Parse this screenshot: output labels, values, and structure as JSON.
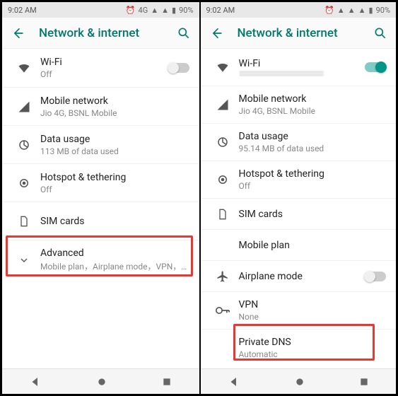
{
  "left": {
    "status": {
      "time": "9:02 AM",
      "battery": "90%"
    },
    "appbar": {
      "title": "Network & internet"
    },
    "wifi": {
      "title": "Wi-Fi",
      "sub": "Off",
      "on": false
    },
    "mobile": {
      "title": "Mobile network",
      "sub": "Jio 4G, BSNL Mobile"
    },
    "datausage": {
      "title": "Data usage",
      "sub": "113 MB of data used"
    },
    "hotspot": {
      "title": "Hotspot & tethering",
      "sub": "Off"
    },
    "sim": {
      "title": "SIM cards"
    },
    "advanced": {
      "title": "Advanced",
      "sub": "Mobile plan，Airplane mode，VPN，Priva.."
    }
  },
  "right": {
    "status": {
      "time": "9:02 AM",
      "battery": "90%"
    },
    "appbar": {
      "title": "Network & internet"
    },
    "wifi": {
      "title": "Wi-Fi",
      "on": true
    },
    "mobile": {
      "title": "Mobile network",
      "sub": "Jio 4G, BSNL Mobile"
    },
    "datausage": {
      "title": "Data usage",
      "sub": "95.14 MB of data used"
    },
    "hotspot": {
      "title": "Hotspot & tethering",
      "sub": "Off"
    },
    "sim": {
      "title": "SIM cards"
    },
    "mobileplan": {
      "title": "Mobile plan"
    },
    "airplane": {
      "title": "Airplane mode",
      "on": false
    },
    "vpn": {
      "title": "VPN",
      "sub": "None"
    },
    "pdns": {
      "title": "Private DNS",
      "sub": "Automatic"
    }
  }
}
